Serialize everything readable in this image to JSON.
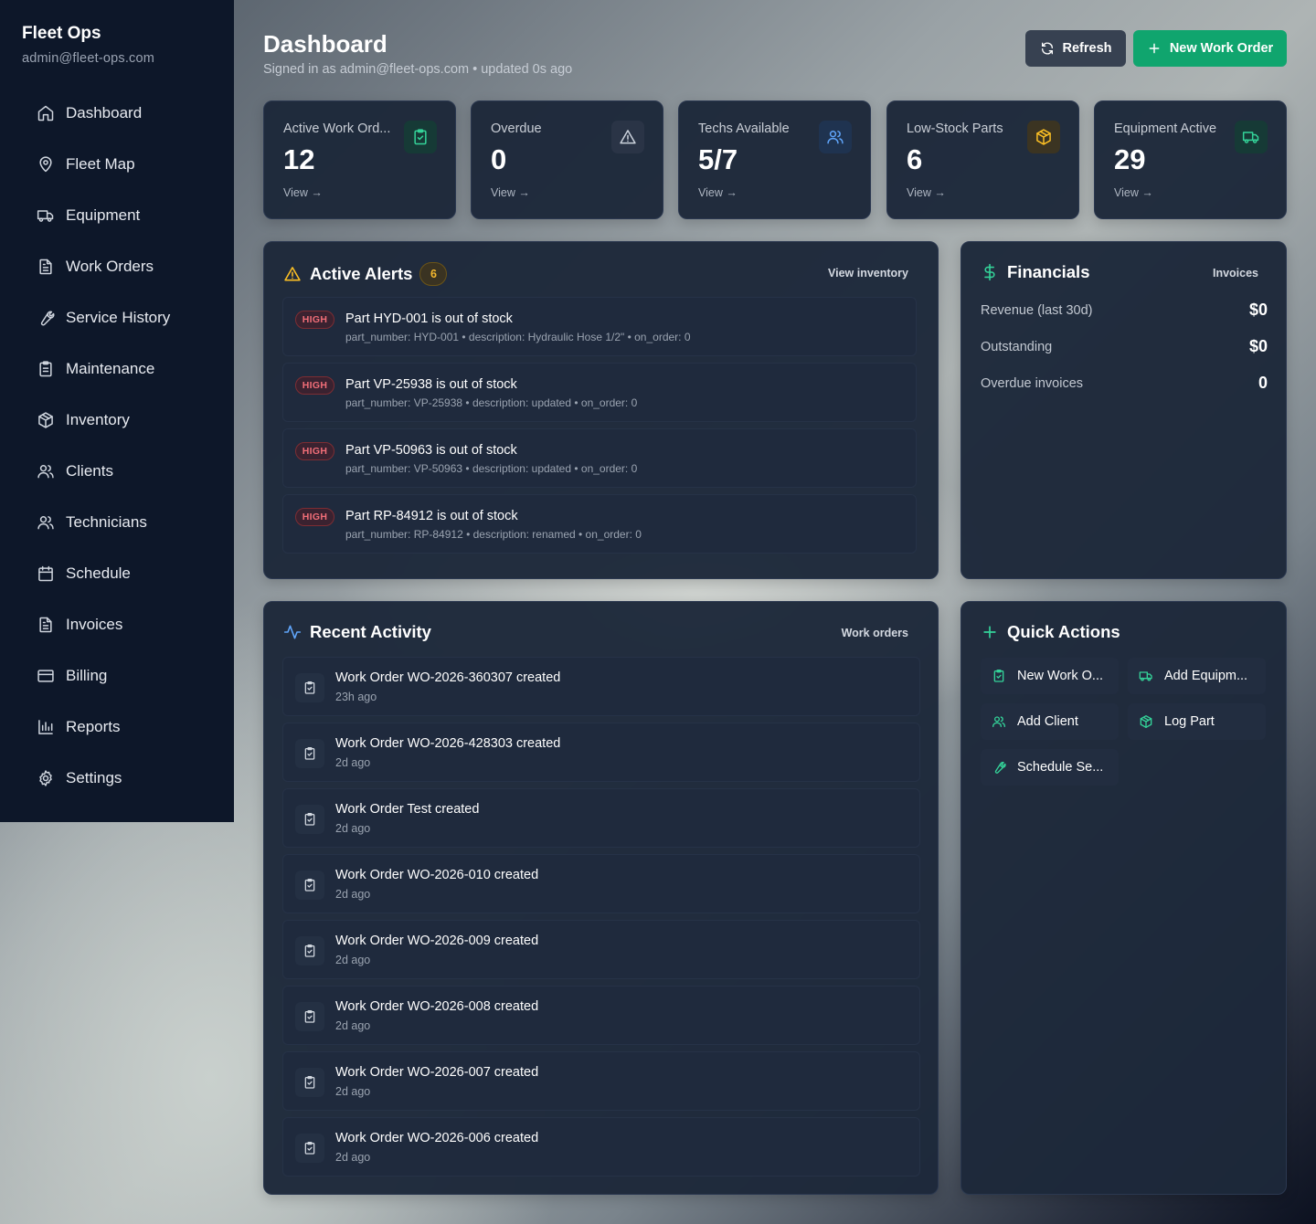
{
  "sidebar": {
    "title": "Fleet Ops",
    "subtitle": "admin@fleet-ops.com",
    "items": [
      {
        "label": "Dashboard",
        "icon": "home-icon"
      },
      {
        "label": "Fleet Map",
        "icon": "map-pin-icon"
      },
      {
        "label": "Equipment",
        "icon": "truck-icon"
      },
      {
        "label": "Work Orders",
        "icon": "file-text-icon"
      },
      {
        "label": "Service History",
        "icon": "wrench-icon"
      },
      {
        "label": "Maintenance",
        "icon": "clipboard-list-icon"
      },
      {
        "label": "Inventory",
        "icon": "package-icon"
      },
      {
        "label": "Clients",
        "icon": "users-icon"
      },
      {
        "label": "Technicians",
        "icon": "users-icon"
      },
      {
        "label": "Schedule",
        "icon": "calendar-icon"
      },
      {
        "label": "Invoices",
        "icon": "file-text-icon"
      },
      {
        "label": "Billing",
        "icon": "credit-card-icon"
      },
      {
        "label": "Reports",
        "icon": "bar-chart-icon"
      },
      {
        "label": "Settings",
        "icon": "gear-icon"
      }
    ]
  },
  "header": {
    "title": "Dashboard",
    "subtitle": "Signed in as admin@fleet-ops.com • updated 0s ago",
    "refresh_label": "Refresh",
    "new_label": "New Work Order"
  },
  "stats": [
    {
      "label": "Active Work Ord...",
      "value": "12",
      "link": "View →",
      "icon": "clipboard-check-icon",
      "color": "#34d399"
    },
    {
      "label": "Overdue",
      "value": "0",
      "link": "View →",
      "icon": "alert-triangle-icon",
      "color": "#cbd2dc"
    },
    {
      "label": "Techs Available",
      "value": "5/7",
      "link": "View →",
      "icon": "users-icon",
      "color": "#60a5fa"
    },
    {
      "label": "Low-Stock Parts",
      "value": "6",
      "link": "View →",
      "icon": "package-icon",
      "color": "#fbbf24"
    },
    {
      "label": "Equipment Active",
      "value": "29",
      "link": "View →",
      "icon": "truck-icon",
      "color": "#34d399"
    }
  ],
  "alerts": {
    "title": "Active Alerts",
    "count": "6",
    "link": "View inventory",
    "items": [
      {
        "severity": "HIGH",
        "title": "Part HYD-001 is out of stock",
        "meta": "part_number: HYD-001 • description: Hydraulic Hose 1/2\" • on_order: 0"
      },
      {
        "severity": "HIGH",
        "title": "Part VP-25938 is out of stock",
        "meta": "part_number: VP-25938 • description: updated • on_order: 0"
      },
      {
        "severity": "HIGH",
        "title": "Part VP-50963 is out of stock",
        "meta": "part_number: VP-50963 • description: updated • on_order: 0"
      },
      {
        "severity": "HIGH",
        "title": "Part RP-84912 is out of stock",
        "meta": "part_number: RP-84912 • description: renamed • on_order: 0"
      }
    ]
  },
  "financials": {
    "title": "Financials",
    "link": "Invoices",
    "rows": [
      {
        "label": "Revenue (last 30d)",
        "value": "$0"
      },
      {
        "label": "Outstanding",
        "value": "$0"
      },
      {
        "label": "Overdue invoices",
        "value": "0"
      }
    ]
  },
  "activity": {
    "title": "Recent Activity",
    "link": "Work orders",
    "items": [
      {
        "title": "Work Order WO-2026-360307 created",
        "time": "23h ago"
      },
      {
        "title": "Work Order WO-2026-428303 created",
        "time": "2d ago"
      },
      {
        "title": "Work Order Test created",
        "time": "2d ago"
      },
      {
        "title": "Work Order WO-2026-010 created",
        "time": "2d ago"
      },
      {
        "title": "Work Order WO-2026-009 created",
        "time": "2d ago"
      },
      {
        "title": "Work Order WO-2026-008 created",
        "time": "2d ago"
      },
      {
        "title": "Work Order WO-2026-007 created",
        "time": "2d ago"
      },
      {
        "title": "Work Order WO-2026-006 created",
        "time": "2d ago"
      }
    ]
  },
  "quick_actions": {
    "title": "Quick Actions",
    "items": [
      {
        "label": "New Work O...",
        "icon": "clipboard-check-icon"
      },
      {
        "label": "Add Equipm...",
        "icon": "truck-icon"
      },
      {
        "label": "Add Client",
        "icon": "users-icon"
      },
      {
        "label": "Log Part",
        "icon": "package-icon"
      },
      {
        "label": "Schedule Se...",
        "icon": "wrench-icon"
      }
    ]
  },
  "colors": {
    "sidebar_bg": "#0d1729",
    "card_bg": "#1d283a",
    "accent_green": "#10a56e",
    "warning": "#f5b82e",
    "danger": "#f16e78"
  }
}
